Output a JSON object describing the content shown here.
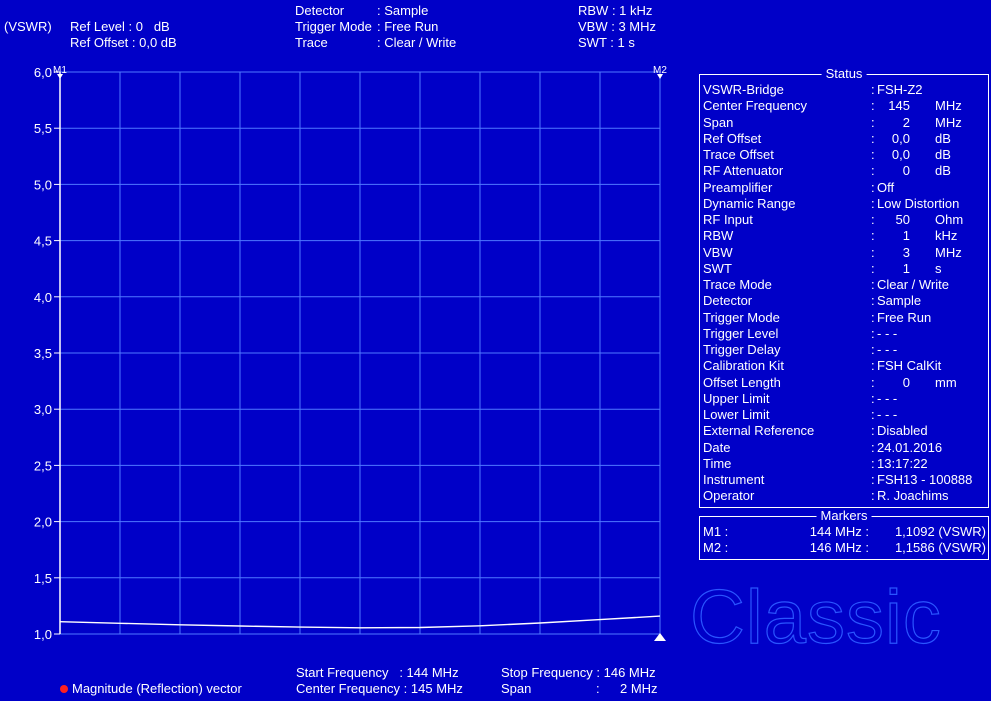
{
  "header": {
    "unit": "(VSWR)",
    "ref_level": "Ref Level : 0   dB",
    "ref_offset": "Ref Offset : 0,0 dB",
    "detector_label": "Detector",
    "detector_value": ": Sample",
    "trigger_label": "Trigger Mode",
    "trigger_value": ": Free Run",
    "trace_label": "Trace",
    "trace_value": ": Clear / Write",
    "rbw": "RBW : 1 kHz",
    "vbw": "VBW : 3 MHz",
    "swt": "SWT : 1 s"
  },
  "footer": {
    "start_freq": "Start Frequency   : 144 MHz",
    "center_freq": "Center Frequency : 145 MHz",
    "stop_freq": "Stop Frequency : 146 MHz",
    "span_label": "Span",
    "span_colon": ":",
    "span_value": "2 MHz",
    "legend": "Magnitude (Reflection) vector"
  },
  "status": {
    "title": "Status",
    "rows": [
      {
        "k": "VSWR-Bridge",
        "v": "FSH-Z2"
      },
      {
        "k": "Center Frequency",
        "n": "145",
        "u": "MHz"
      },
      {
        "k": "Span",
        "n": "2",
        "u": "MHz"
      },
      {
        "k": "Ref Offset",
        "n": "0,0",
        "u": "dB"
      },
      {
        "k": "Trace Offset",
        "n": "0,0",
        "u": "dB"
      },
      {
        "k": "RF Attenuator",
        "n": "0",
        "u": "dB"
      },
      {
        "k": "Preamplifier",
        "v": "Off"
      },
      {
        "k": "Dynamic Range",
        "v": "Low Distortion"
      },
      {
        "k": "RF Input",
        "n": "50",
        "u": "Ohm"
      },
      {
        "k": "RBW",
        "n": "1",
        "u": "kHz"
      },
      {
        "k": "VBW",
        "n": "3",
        "u": "MHz"
      },
      {
        "k": "SWT",
        "n": "1",
        "u": "s"
      },
      {
        "k": "Trace Mode",
        "v": "Clear / Write"
      },
      {
        "k": "Detector",
        "v": "Sample"
      },
      {
        "k": "Trigger Mode",
        "v": "Free Run"
      },
      {
        "k": "Trigger Level",
        "v": "- - -"
      },
      {
        "k": "Trigger Delay",
        "v": "- - -"
      },
      {
        "k": "Calibration Kit",
        "v": "FSH CalKit"
      },
      {
        "k": "Offset Length",
        "n": "0",
        "u": "mm"
      },
      {
        "k": "Upper Limit",
        "v": "- - -"
      },
      {
        "k": "Lower Limit",
        "v": "- - -"
      },
      {
        "k": "External Reference",
        "v": "Disabled"
      },
      {
        "k": "Date",
        "v": "24.01.2016"
      },
      {
        "k": "Time",
        "v": "13:17:22"
      },
      {
        "k": "Instrument",
        "v": "FSH13 - 100888"
      },
      {
        "k": "Operator",
        "v": "R. Joachims"
      }
    ]
  },
  "markers": {
    "title": "Markers",
    "m1_label": "M1 :",
    "m1_freq": "144 MHz :",
    "m1_value": "1,1092 (VSWR)",
    "m2_label": "M2 :",
    "m2_freq": "146 MHz :",
    "m2_value": "1,1586 (VSWR)"
  },
  "watermark": "Classic",
  "colors": {
    "background": "#0000c8",
    "grid": "#4f78ff",
    "trace": "#ffffff",
    "marker_text": "#ffffff"
  },
  "chart_data": {
    "type": "line",
    "ylabel": "(VSWR)",
    "ylim": [
      1.0,
      6.0
    ],
    "xlim": [
      144,
      146
    ],
    "y_ticks": [
      "1,0",
      "1,5",
      "2,0",
      "2,5",
      "3,0",
      "3,5",
      "4,0",
      "4,5",
      "5,0",
      "5,5",
      "6,0"
    ],
    "y_tick_values": [
      1.0,
      1.5,
      2.0,
      2.5,
      3.0,
      3.5,
      4.0,
      4.5,
      5.0,
      5.5,
      6.0
    ],
    "grid": true,
    "series": [
      {
        "x": [
          144.0,
          144.2,
          144.4,
          144.6,
          144.8,
          145.0,
          145.2,
          145.4,
          145.6,
          145.8,
          146.0
        ],
        "values": [
          1.109,
          1.095,
          1.082,
          1.071,
          1.061,
          1.055,
          1.058,
          1.073,
          1.098,
          1.128,
          1.159
        ]
      }
    ],
    "markers": [
      {
        "label": "M1",
        "x": 144,
        "y": 1.1092
      },
      {
        "label": "M2",
        "x": 146,
        "y": 1.1586
      }
    ]
  }
}
